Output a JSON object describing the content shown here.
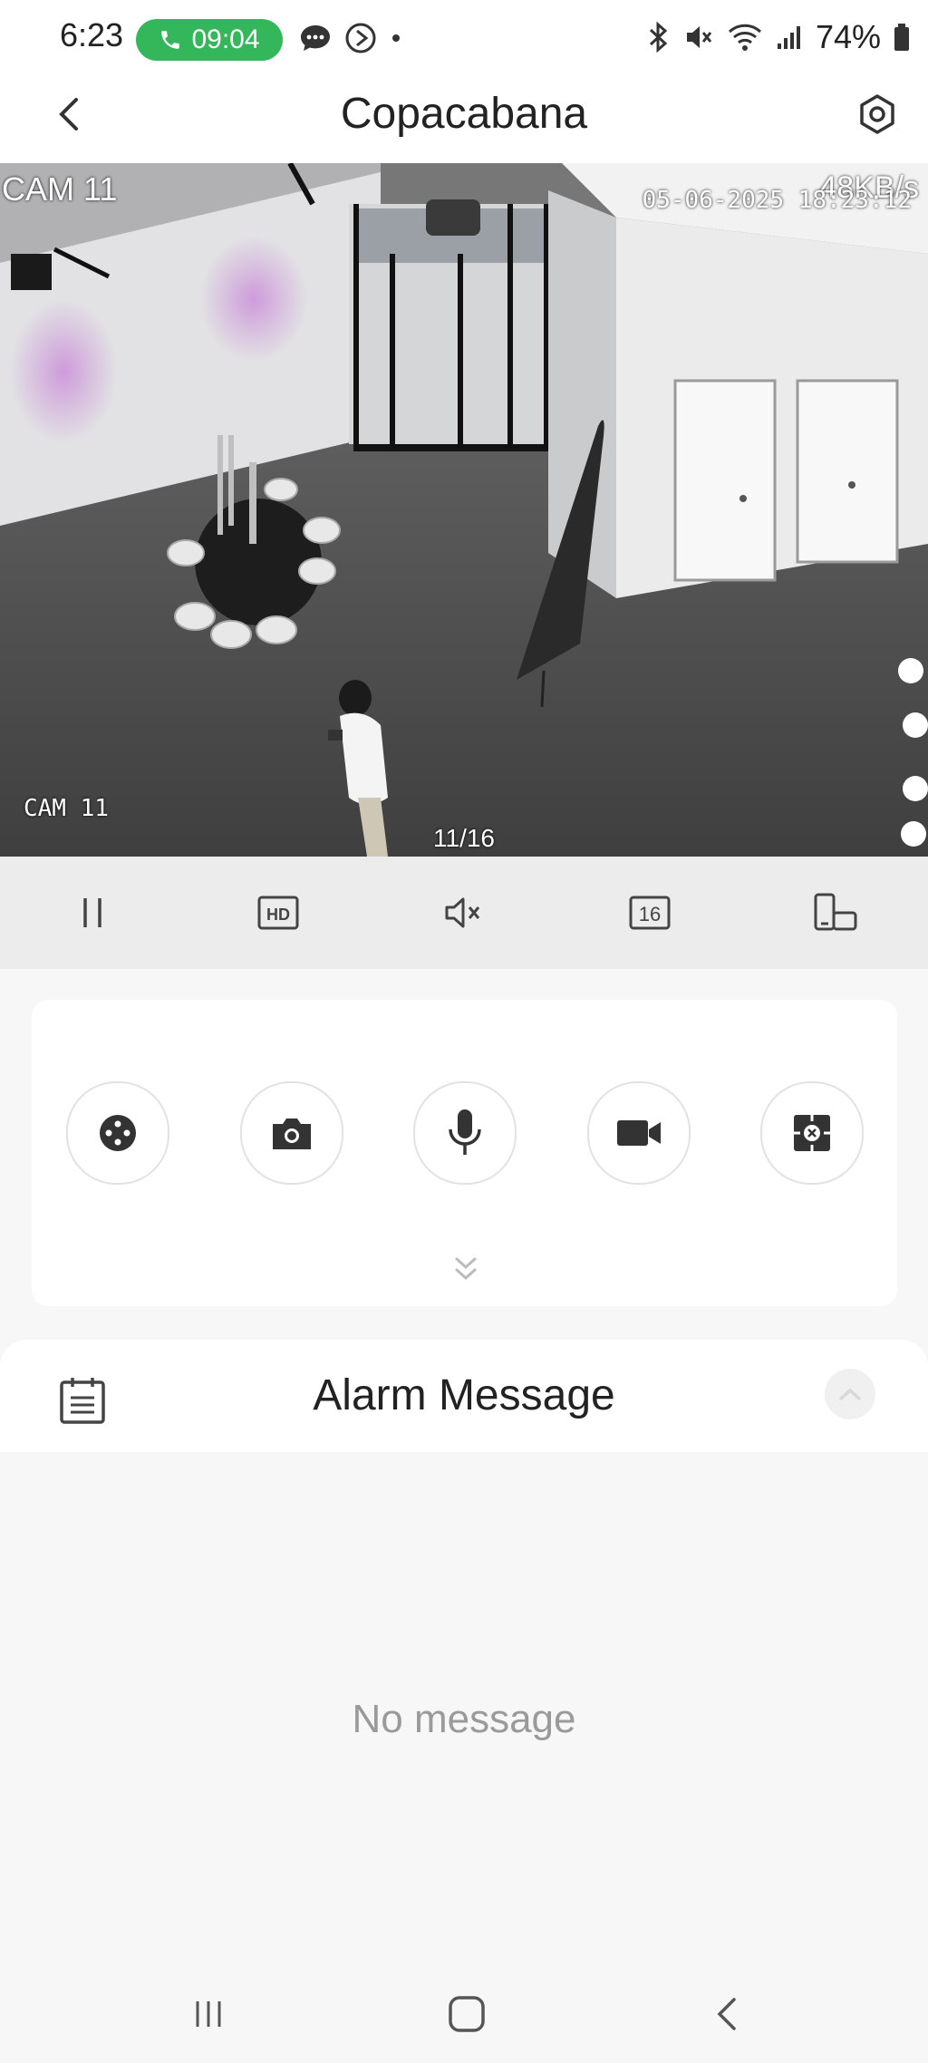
{
  "status_bar": {
    "time": "6:23",
    "call_timer": "09:04",
    "battery": "74%",
    "icons": [
      "phone-icon",
      "chat-bubble-icon",
      "circle-play-icon",
      "dot-icon",
      "bluetooth-icon",
      "mute-icon",
      "wifi-icon",
      "signal-icon",
      "battery-icon"
    ]
  },
  "header": {
    "title": "Copacabana",
    "back_icon": "back-chevron-icon",
    "settings_icon": "settings-hexagon-icon"
  },
  "video": {
    "camera_label": "CAM 11",
    "bitrate": "48KB/s",
    "timestamp": "05-06-2025 18:23:12",
    "camera_label_overlay": "CAM 11",
    "channel": "11/16"
  },
  "player_controls": {
    "pause_icon": "pause-icon",
    "hd_label": "HD",
    "mute_icon": "speaker-muted-icon",
    "grid_label": "16",
    "rotate_icon": "rotate-screen-icon"
  },
  "actions": [
    {
      "name": "ptz-button",
      "icon": "ptz-joystick-icon"
    },
    {
      "name": "snapshot-button",
      "icon": "camera-icon"
    },
    {
      "name": "talk-button",
      "icon": "microphone-icon"
    },
    {
      "name": "record-button",
      "icon": "video-camera-icon"
    },
    {
      "name": "focus-button",
      "icon": "crosshair-icon"
    }
  ],
  "alarm": {
    "title": "Alarm Message",
    "empty_text": "No message"
  },
  "colors": {
    "call_pill": "#34b75a",
    "control_bar": "#ececec",
    "background": "#f7f7f7",
    "icon": "#444444"
  }
}
